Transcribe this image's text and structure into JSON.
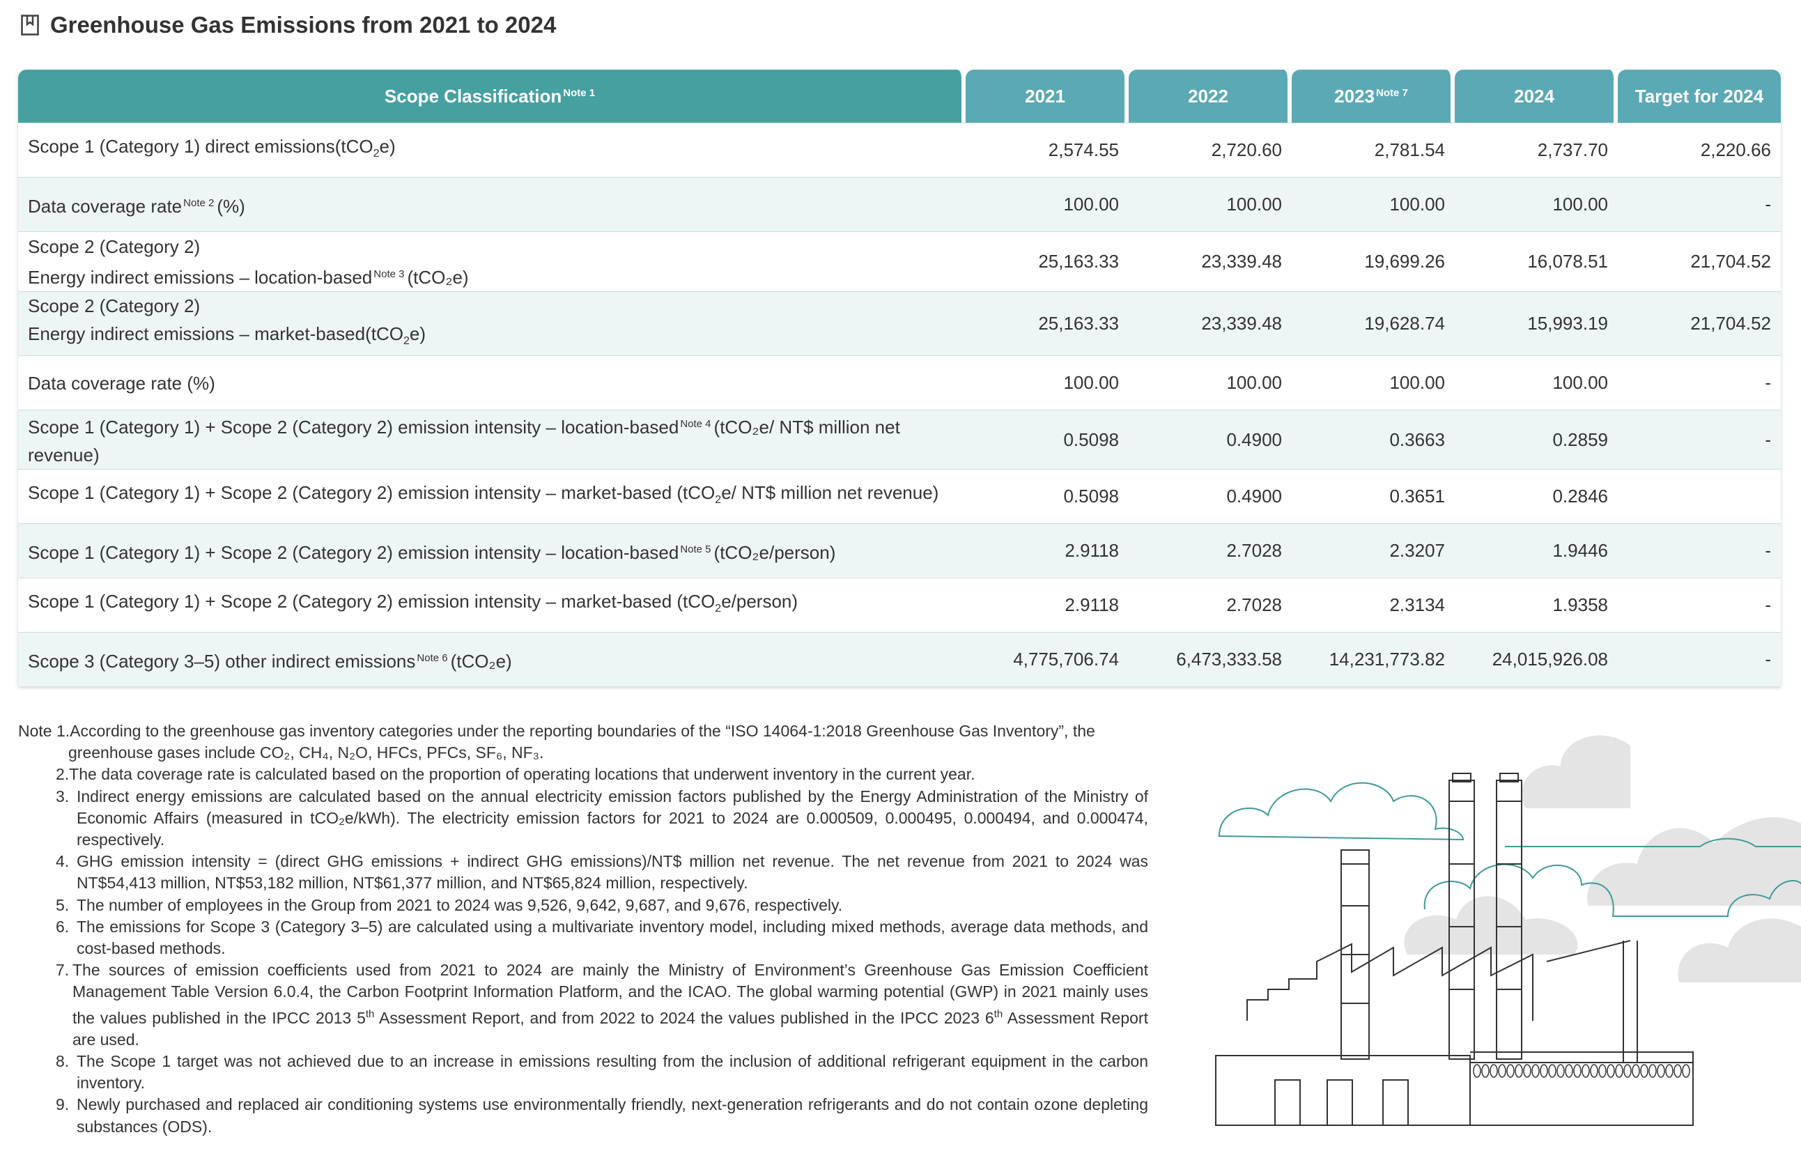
{
  "title": "Greenhouse Gas Emissions from 2021 to 2024",
  "icon": "bookmark-icon",
  "colors": {
    "header_scope": "#46a0a0",
    "header_year": "#5ba9b4",
    "row_alt": "#eef6f5",
    "accent": "#3d9a96"
  },
  "table": {
    "headers": [
      {
        "label": "Scope Classification",
        "note": "Note 1"
      },
      {
        "label": "2021",
        "note": ""
      },
      {
        "label": "2022",
        "note": ""
      },
      {
        "label": "2023",
        "note": "Note 7"
      },
      {
        "label": "2024",
        "note": ""
      },
      {
        "label": "Target for 2024",
        "note": ""
      }
    ],
    "rows": [
      {
        "line1": "",
        "pre": "Scope 1 (Category 1) direct emissions(tCO",
        "sub": "2",
        "note": "",
        "post": "e)",
        "values": [
          "2,574.55",
          "2,720.60",
          "2,781.54",
          "2,737.70",
          "2,220.66"
        ]
      },
      {
        "line1": "",
        "pre": "Data coverage rate",
        "sub": "",
        "note": "Note 2",
        "post": "(%)",
        "values": [
          "100.00",
          "100.00",
          "100.00",
          "100.00",
          "-"
        ]
      },
      {
        "line1": "Scope 2 (Category 2)",
        "pre": "Energy indirect emissions – location-based",
        "sub": "",
        "note": "Note 3",
        "post": "(tCO₂e)",
        "values": [
          "25,163.33",
          "23,339.48",
          "19,699.26",
          "16,078.51",
          "21,704.52"
        ]
      },
      {
        "line1": "Scope 2 (Category 2)",
        "pre": "Energy indirect emissions – market-based(tCO",
        "sub": "2",
        "note": "",
        "post": "e)",
        "values": [
          "25,163.33",
          "23,339.48",
          "19,628.74",
          "15,993.19",
          "21,704.52"
        ]
      },
      {
        "line1": "",
        "pre": "Data coverage rate (%)",
        "sub": "",
        "note": "",
        "post": "",
        "values": [
          "100.00",
          "100.00",
          "100.00",
          "100.00",
          "-"
        ]
      },
      {
        "line1": "",
        "pre": "Scope 1 (Category 1) + Scope 2 (Category 2) emission intensity – location-based",
        "sub": "",
        "note": "Note 4",
        "post": "(tCO₂e/ NT$ million net revenue)",
        "values": [
          "0.5098",
          "0.4900",
          "0.3663",
          "0.2859",
          "-"
        ]
      },
      {
        "line1": "",
        "pre": "Scope 1 (Category 1) + Scope 2 (Category 2) emission intensity – market-based (tCO",
        "sub": "2",
        "note": "",
        "post": "e/ NT$ million net revenue)",
        "values": [
          "0.5098",
          "0.4900",
          "0.3651",
          "0.2846",
          ""
        ]
      },
      {
        "line1": "",
        "pre": "Scope 1 (Category 1) + Scope 2 (Category 2) emission intensity – location-based",
        "sub": "",
        "note": "Note 5",
        "post": "(tCO₂e/person)",
        "values": [
          "2.9118",
          "2.7028",
          "2.3207",
          "1.9446",
          "-"
        ]
      },
      {
        "line1": "",
        "pre": "Scope 1 (Category 1) + Scope 2 (Category 2) emission intensity – market-based (tCO",
        "sub": "2",
        "note": "",
        "post": "e/person)",
        "values": [
          "2.9118",
          "2.7028",
          "2.3134",
          "1.9358",
          "-"
        ]
      },
      {
        "line1": "",
        "pre": "Scope 3 (Category 3–5) other indirect emissions",
        "sub": "",
        "note": "Note 6",
        "post": "(tCO₂e)",
        "values": [
          "4,775,706.74",
          "6,473,333.58",
          "14,231,773.82",
          "24,015,926.08",
          "-"
        ]
      }
    ]
  },
  "notes": {
    "n1_prefix": "Note 1.",
    "n1_text": "According to the greenhouse gas inventory categories under the reporting boundaries of the “ISO 14064-1:2018 Greenhouse Gas Inventory”, the",
    "n1_gases": "greenhouse gases include CO₂, CH₄, N₂O, HFCs, PFCs, SF₆, NF₃.",
    "n2": "2.The data coverage rate is calculated based on the proportion of operating locations that underwent inventory in the current year.",
    "items": [
      {
        "num": "3.",
        "text": "Indirect energy emissions are calculated based on the annual electricity emission factors published by the Energy Administration of the Ministry of Economic Affairs (measured in tCO₂e/kWh). The electricity emission factors for 2021 to 2024 are 0.000509, 0.000495, 0.000494, and 0.000474, respectively."
      },
      {
        "num": "4.",
        "text": "GHG emission intensity = (direct GHG emissions + indirect GHG emissions)/NT$ million net revenue. The net revenue from 2021 to 2024 was NT$54,413 million, NT$53,182 million, NT$61,377 million, and NT$65,824 million, respectively."
      },
      {
        "num": "5.",
        "text": "The number of employees in the Group from 2021 to 2024 was 9,526, 9,642, 9,687, and 9,676, respectively."
      },
      {
        "num": "6.",
        "text": "The emissions for Scope 3 (Category 3–5) are calculated using a multivariate inventory model, including mixed methods, average data methods, and cost-based methods."
      }
    ],
    "n7_num": "7.",
    "n7_a": "The sources of emission coefficients used from 2021 to 2024 are mainly the Ministry of Environment’s Greenhouse Gas Emission Coefficient Management Table Version 6.0.4, the Carbon Footprint Information Platform, and the ICAO. The global warming potential (GWP) in 2021 mainly uses the values published in the IPCC 2013 5",
    "n7_sup1": "th",
    "n7_b": " Assessment Report, and from 2022 to 2024 the values published in the IPCC 2023 6",
    "n7_sup2": "th",
    "n7_c": " Assessment Report are used.",
    "items2": [
      {
        "num": "8.",
        "text": "The Scope 1 target was not achieved due to an increase in emissions resulting from the inclusion of additional refrigerant equipment in the carbon inventory."
      },
      {
        "num": "9.",
        "text": "Newly purchased and replaced air conditioning systems use environmentally friendly, next-generation refrigerants and do not contain ozone depleting substances (ODS)."
      }
    ]
  }
}
